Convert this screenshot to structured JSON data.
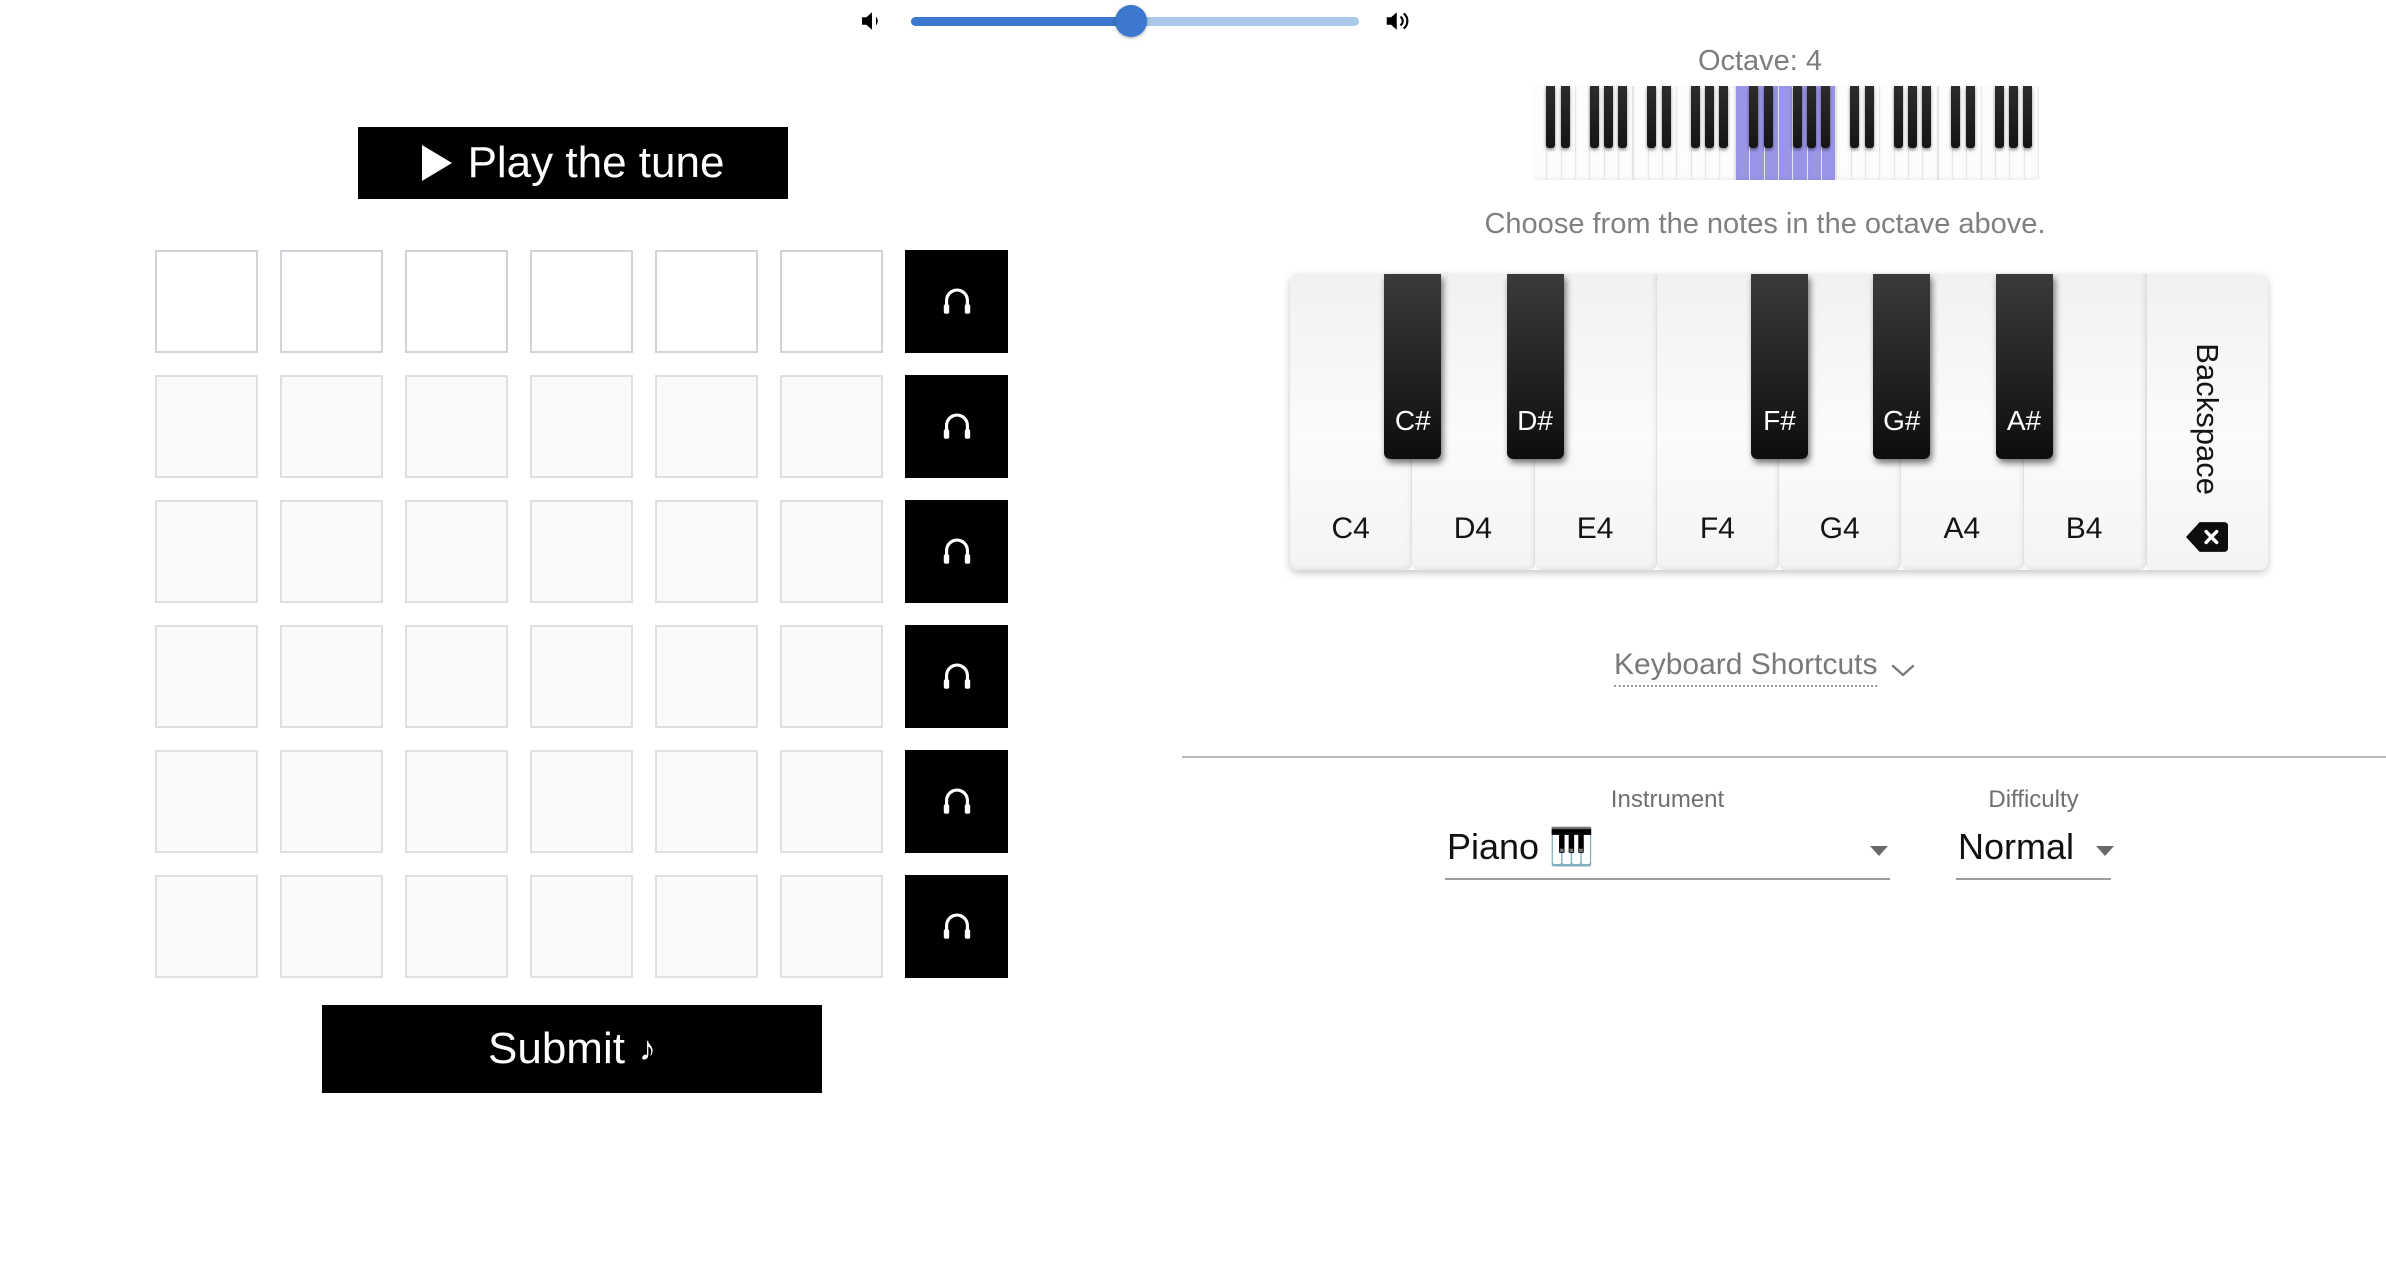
{
  "volume": {
    "icon_low": "volume-low-icon",
    "icon_high": "volume-high-icon",
    "value_percent": 49,
    "fill_color": "#3b78ce",
    "track_color": "#a8c7ea"
  },
  "play": {
    "label": "Play the tune",
    "icon": "play-triangle-icon"
  },
  "grid": {
    "rows": 6,
    "columns": 6,
    "active_row_index": 0,
    "listen_icon": "headphones-icon",
    "cells": [
      [
        "",
        "",
        "",
        "",
        "",
        ""
      ],
      [
        "",
        "",
        "",
        "",
        "",
        ""
      ],
      [
        "",
        "",
        "",
        "",
        "",
        ""
      ],
      [
        "",
        "",
        "",
        "",
        "",
        ""
      ],
      [
        "",
        "",
        "",
        "",
        "",
        ""
      ],
      [
        "",
        "",
        "",
        "",
        "",
        ""
      ]
    ]
  },
  "submit": {
    "label": "Submit",
    "note_glyph": "♪"
  },
  "octave": {
    "label": "Octave: 4",
    "mini_keyboard": {
      "octave_count": 5,
      "highlighted_index": 2,
      "highlight_color": "#9b95ea"
    }
  },
  "hint": "Choose from the notes in the octave above.",
  "piano": {
    "white_keys": [
      "C4",
      "D4",
      "E4",
      "F4",
      "G4",
      "A4",
      "B4"
    ],
    "black_keys": [
      "C#",
      "D#",
      "F#",
      "G#",
      "A#"
    ],
    "backspace": {
      "label": "Backspace",
      "icon": "backspace-icon"
    }
  },
  "keyboard_shortcuts": {
    "label": "Keyboard Shortcuts",
    "icon": "chevron-down-icon"
  },
  "settings": {
    "instrument": {
      "label": "Instrument",
      "value": "Piano 🎹",
      "icon": "chevron-down-icon"
    },
    "difficulty": {
      "label": "Difficulty",
      "value": "Normal",
      "icon": "chevron-down-icon"
    }
  }
}
